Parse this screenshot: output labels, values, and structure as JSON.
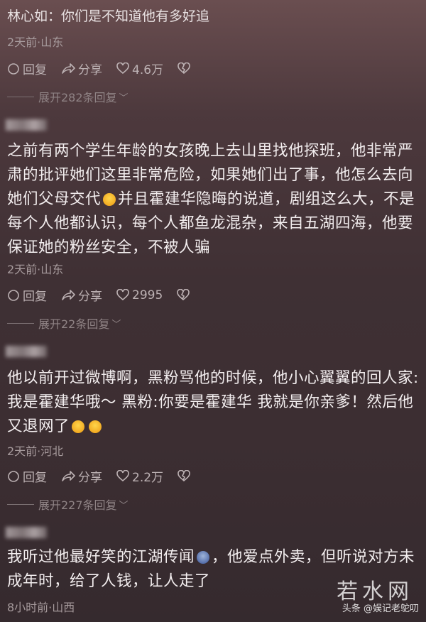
{
  "comments": [
    {
      "author": "林心如",
      "text": "你们是不知道他有多好追",
      "meta": "2天前·山东",
      "reply_label": "回复",
      "share_label": "分享",
      "likes": "4.6万",
      "expand_label": "展开282条回复"
    },
    {
      "text_part1": "之前有两个学生年龄的女孩晚上去山里找他探班，他非常严肃的批评她们这里非常危险，如果她们出了事，他怎么去向她们父母交代",
      "text_part2": "并且霍建华隐晦的说道，剧组这么大，不是每个人他都认识，每个人都鱼龙混杂，来自五湖四海，他要保证她的粉丝安全，不被人骗",
      "meta": "2天前·山东",
      "reply_label": "回复",
      "share_label": "分享",
      "likes": "2995",
      "expand_label": "展开22条回复"
    },
    {
      "text": "他以前开过微博啊，黑粉骂他的时候，他小心翼翼的回人家:我是霍建华哦～ 黑粉:你要是霍建华 我就是你亲爹！然后他又退网了",
      "meta": "2天前·河北",
      "reply_label": "回复",
      "share_label": "分享",
      "likes": "2.2万",
      "expand_label": "展开227条回复"
    },
    {
      "text_part1": "我听过他最好笑的江湖传闻",
      "text_part2": "，他爱点外卖，但听说对方未成年时，给了人钱，让人走了",
      "meta": "8小时前·山西"
    }
  ],
  "watermark": {
    "site": "若水网",
    "source": "头条 @娱记老鸵叨"
  },
  "icons": {
    "reply": "reply-bubble-icon",
    "share": "share-arrow-icon",
    "like": "heart-icon",
    "dislike": "broken-heart-icon",
    "expand": "chevron-down-icon"
  }
}
